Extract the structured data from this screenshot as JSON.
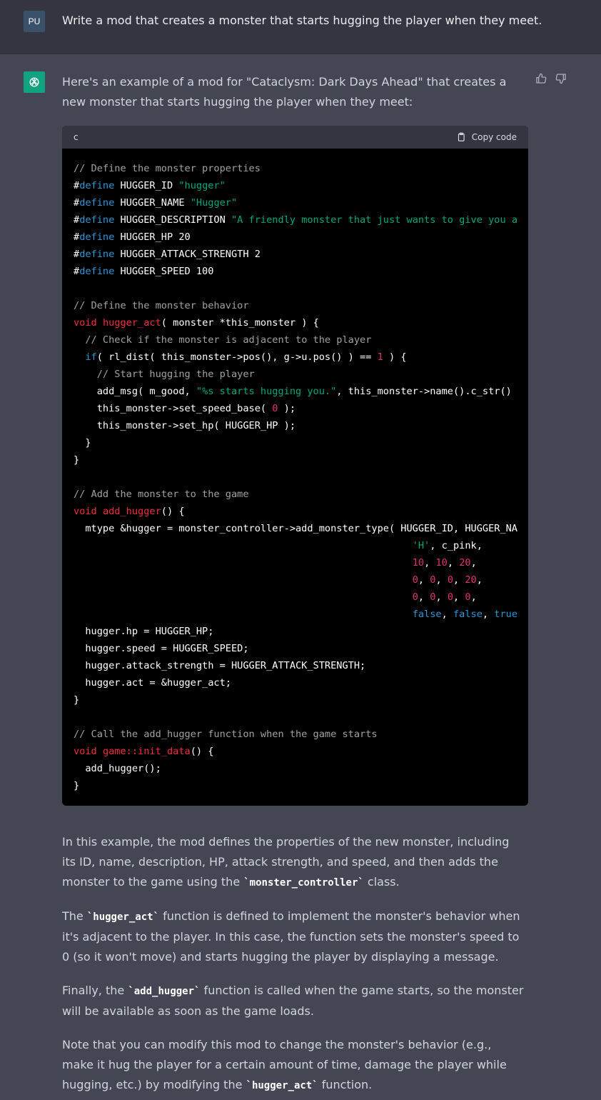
{
  "user": {
    "avatar": "PU",
    "message": "Write a mod that creates a monster that starts hugging the player when they meet."
  },
  "assistant": {
    "intro": "Here's an example of a mod for \"Cataclysm: Dark Days Ahead\" that creates a new monster that starts hugging the player when they meet:",
    "code_language": "c",
    "copy_label": "Copy code",
    "code_lines": [
      [
        [
          "cm",
          "// Define the monster properties"
        ]
      ],
      [
        [
          "",
          "#"
        ],
        [
          "kw",
          "define"
        ],
        [
          "",
          " HUGGER_ID "
        ],
        [
          "str",
          "\"hugger\""
        ]
      ],
      [
        [
          "",
          "#"
        ],
        [
          "kw",
          "define"
        ],
        [
          "",
          " HUGGER_NAME "
        ],
        [
          "str",
          "\"Hugger\""
        ]
      ],
      [
        [
          "",
          "#"
        ],
        [
          "kw",
          "define"
        ],
        [
          "",
          " HUGGER_DESCRIPTION "
        ],
        [
          "str",
          "\"A friendly monster that just wants to give you a"
        ]
      ],
      [
        [
          "",
          "#"
        ],
        [
          "kw",
          "define"
        ],
        [
          "",
          " HUGGER_HP 20"
        ]
      ],
      [
        [
          "",
          "#"
        ],
        [
          "kw",
          "define"
        ],
        [
          "",
          " HUGGER_ATTACK_STRENGTH 2"
        ]
      ],
      [
        [
          "",
          "#"
        ],
        [
          "kw",
          "define"
        ],
        [
          "",
          " HUGGER_SPEED 100"
        ]
      ],
      [
        [
          "",
          ""
        ]
      ],
      [
        [
          "cm",
          "// Define the monster behavior"
        ]
      ],
      [
        [
          "fn",
          "void"
        ],
        [
          "",
          " "
        ],
        [
          "fn",
          "hugger_act"
        ],
        [
          "",
          "( monster *this_monster ) {"
        ]
      ],
      [
        [
          "",
          "  "
        ],
        [
          "cm",
          "// Check if the monster is adjacent to the player"
        ]
      ],
      [
        [
          "",
          "  "
        ],
        [
          "kw",
          "if"
        ],
        [
          "",
          "( rl_dist( this_monster->pos(), g->u.pos() ) == "
        ],
        [
          "num",
          "1"
        ],
        [
          "",
          " ) {"
        ]
      ],
      [
        [
          "",
          "    "
        ],
        [
          "cm",
          "// Start hugging the player"
        ]
      ],
      [
        [
          "",
          "    add_msg( m_good, "
        ],
        [
          "str",
          "\"%s starts hugging you.\""
        ],
        [
          "",
          ", this_monster->name().c_str()"
        ]
      ],
      [
        [
          "",
          "    this_monster->set_speed_base( "
        ],
        [
          "num",
          "0"
        ],
        [
          "",
          " );"
        ]
      ],
      [
        [
          "",
          "    this_monster->set_hp( HUGGER_HP );"
        ]
      ],
      [
        [
          "",
          "  }"
        ]
      ],
      [
        [
          "",
          "}"
        ]
      ],
      [
        [
          "",
          ""
        ]
      ],
      [
        [
          "cm",
          "// Add the monster to the game"
        ]
      ],
      [
        [
          "fn",
          "void"
        ],
        [
          "",
          " "
        ],
        [
          "fn",
          "add_hugger"
        ],
        [
          "",
          "() {"
        ]
      ],
      [
        [
          "",
          "  mtype &hugger = monster_controller->add_monster_type( HUGGER_ID, HUGGER_NA"
        ]
      ],
      [
        [
          "",
          "                                                          "
        ],
        [
          "str",
          "'H'"
        ],
        [
          "",
          ", c_pink,"
        ]
      ],
      [
        [
          "",
          "                                                          "
        ],
        [
          "num",
          "10"
        ],
        [
          "",
          ", "
        ],
        [
          "num",
          "10"
        ],
        [
          "",
          ", "
        ],
        [
          "num",
          "20"
        ],
        [
          "",
          ","
        ]
      ],
      [
        [
          "",
          "                                                          "
        ],
        [
          "num",
          "0"
        ],
        [
          "",
          ", "
        ],
        [
          "num",
          "0"
        ],
        [
          "",
          ", "
        ],
        [
          "num",
          "0"
        ],
        [
          "",
          ", "
        ],
        [
          "num",
          "20"
        ],
        [
          "",
          ","
        ]
      ],
      [
        [
          "",
          "                                                          "
        ],
        [
          "num",
          "0"
        ],
        [
          "",
          ", "
        ],
        [
          "num",
          "0"
        ],
        [
          "",
          ", "
        ],
        [
          "num",
          "0"
        ],
        [
          "",
          ", "
        ],
        [
          "num",
          "0"
        ],
        [
          "",
          ","
        ]
      ],
      [
        [
          "",
          "                                                          "
        ],
        [
          "kw",
          "false"
        ],
        [
          "",
          ", "
        ],
        [
          "kw",
          "false"
        ],
        [
          "",
          ", "
        ],
        [
          "kw",
          "true"
        ]
      ],
      [
        [
          "",
          "  hugger.hp = HUGGER_HP;"
        ]
      ],
      [
        [
          "",
          "  hugger.speed = HUGGER_SPEED;"
        ]
      ],
      [
        [
          "",
          "  hugger.attack_strength = HUGGER_ATTACK_STRENGTH;"
        ]
      ],
      [
        [
          "",
          "  hugger.act = &hugger_act;"
        ]
      ],
      [
        [
          "",
          "}"
        ]
      ],
      [
        [
          "",
          ""
        ]
      ],
      [
        [
          "cm",
          "// Call the add_hugger function when the game starts"
        ]
      ],
      [
        [
          "fn",
          "void"
        ],
        [
          "",
          " "
        ],
        [
          "fn",
          "game::init_data"
        ],
        [
          "",
          "() {"
        ]
      ],
      [
        [
          "",
          "  add_hugger();"
        ]
      ],
      [
        [
          "",
          "}"
        ]
      ]
    ],
    "paragraphs": [
      [
        [
          "",
          "In this example, the mod defines the properties of the new monster, including its ID, name, description, HP, attack strength, and speed, and then adds the monster to the game using the "
        ],
        [
          "code",
          "`monster_controller`"
        ],
        [
          "",
          " class."
        ]
      ],
      [
        [
          "",
          "The "
        ],
        [
          "code",
          "`hugger_act`"
        ],
        [
          "",
          " function is defined to implement the monster's behavior when it's adjacent to the player. In this case, the function sets the monster's speed to 0 (so it won't move) and starts hugging the player by displaying a message."
        ]
      ],
      [
        [
          "",
          "Finally, the "
        ],
        [
          "code",
          "`add_hugger`"
        ],
        [
          "",
          " function is called when the game starts, so the monster will be available as soon as the game loads."
        ]
      ],
      [
        [
          "",
          "Note that you can modify this mod to change the monster's behavior (e.g., make it hug the player for a certain amount of time, damage the player while hugging, etc.) by modifying the "
        ],
        [
          "code",
          "`hugger_act`"
        ],
        [
          "",
          " function."
        ]
      ]
    ]
  }
}
